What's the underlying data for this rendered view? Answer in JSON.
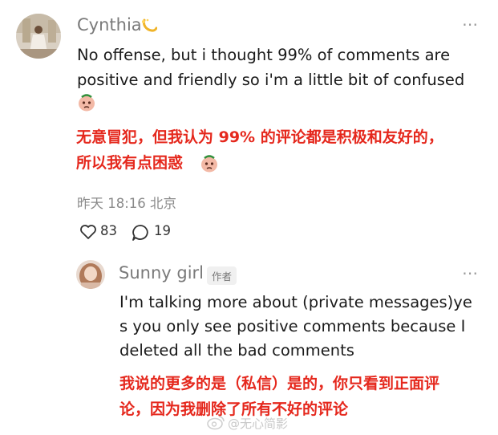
{
  "comment": {
    "user": "Cynthia",
    "text": "No offense, but i thought 99% of comments are positive and friendly so i'm a little bit of confused",
    "translation_line1": "无意冒犯，但我认为 99% 的评论都是积极和友好的，",
    "translation_line2": "所以我有点困惑",
    "timestamp": "昨天 18:16 北京",
    "likes": "83",
    "replies": "19",
    "more": "⋯"
  },
  "reply": {
    "user": "Sunny girl",
    "badge": "作者",
    "text_line1": "I'm talking more about (private messages)ye",
    "text_line2": "s you only see positive comments because I",
    "text_line3": "deleted all the bad comments",
    "translation_line1": "我说的更多的是（私信）是的，你只看到正面评",
    "translation_line2": "论，因为我删除了所有不好的评论",
    "more": "⋯"
  },
  "watermark": "@无心简影",
  "colors": {
    "accent_red": "#e5281d",
    "muted": "#8a8a8a"
  },
  "icons": [
    "sparkle-emoji-icon",
    "sad-face-emoji-icon",
    "heart-icon",
    "comment-icon",
    "more-icon",
    "weibo-logo-icon"
  ]
}
